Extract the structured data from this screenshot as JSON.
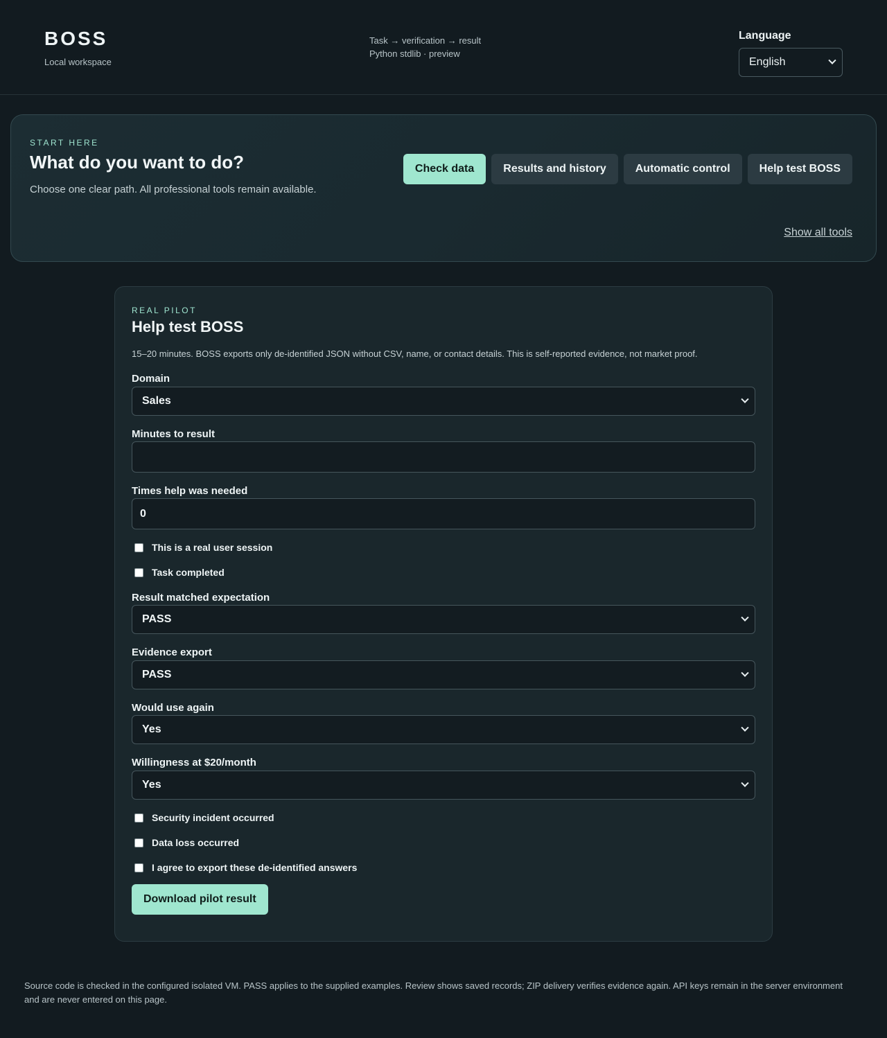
{
  "header": {
    "brand": "BOSS",
    "subtitle": "Local workspace",
    "flow": "Task → verification → result",
    "runtime": "Python stdlib · preview",
    "language_label": "Language",
    "language_value": "English"
  },
  "start": {
    "eyebrow": "START HERE",
    "title": "What do you want to do?",
    "description": "Choose one clear path. All professional tools remain available.",
    "buttons": [
      {
        "label": "Check data",
        "active": true
      },
      {
        "label": "Results and history",
        "active": false
      },
      {
        "label": "Automatic control",
        "active": false
      },
      {
        "label": "Help test BOSS",
        "active": false
      }
    ],
    "show_all": "Show all tools"
  },
  "pilot": {
    "eyebrow": "REAL PILOT",
    "title": "Help test BOSS",
    "description": "15–20 minutes. BOSS exports only de-identified JSON without CSV, name, or contact details. This is self-reported evidence, not market proof.",
    "domain": {
      "label": "Domain",
      "value": "Sales"
    },
    "minutes": {
      "label": "Minutes to result",
      "value": ""
    },
    "help_times": {
      "label": "Times help was needed",
      "value": "0"
    },
    "real_session": {
      "label": "This is a real user session",
      "checked": false
    },
    "task_completed": {
      "label": "Task completed",
      "checked": false
    },
    "result_matched": {
      "label": "Result matched expectation",
      "value": "PASS"
    },
    "evidence_export": {
      "label": "Evidence export",
      "value": "PASS"
    },
    "use_again": {
      "label": "Would use again",
      "value": "Yes"
    },
    "willingness": {
      "label": "Willingness at $20/month",
      "value": "Yes"
    },
    "security_incident": {
      "label": "Security incident occurred",
      "checked": false
    },
    "data_loss": {
      "label": "Data loss occurred",
      "checked": false
    },
    "agree_export": {
      "label": "I agree to export these de-identified answers",
      "checked": false
    },
    "download_label": "Download pilot result"
  },
  "footer": {
    "note": "Source code is checked in the configured isolated VM. PASS applies to the supplied examples. Review shows saved records; ZIP delivery verifies evidence again. API keys remain in the server environment and are never entered on this page."
  },
  "colors": {
    "background": "#121b20",
    "accent": "#9fe6cf",
    "panel": "#1a272c"
  }
}
